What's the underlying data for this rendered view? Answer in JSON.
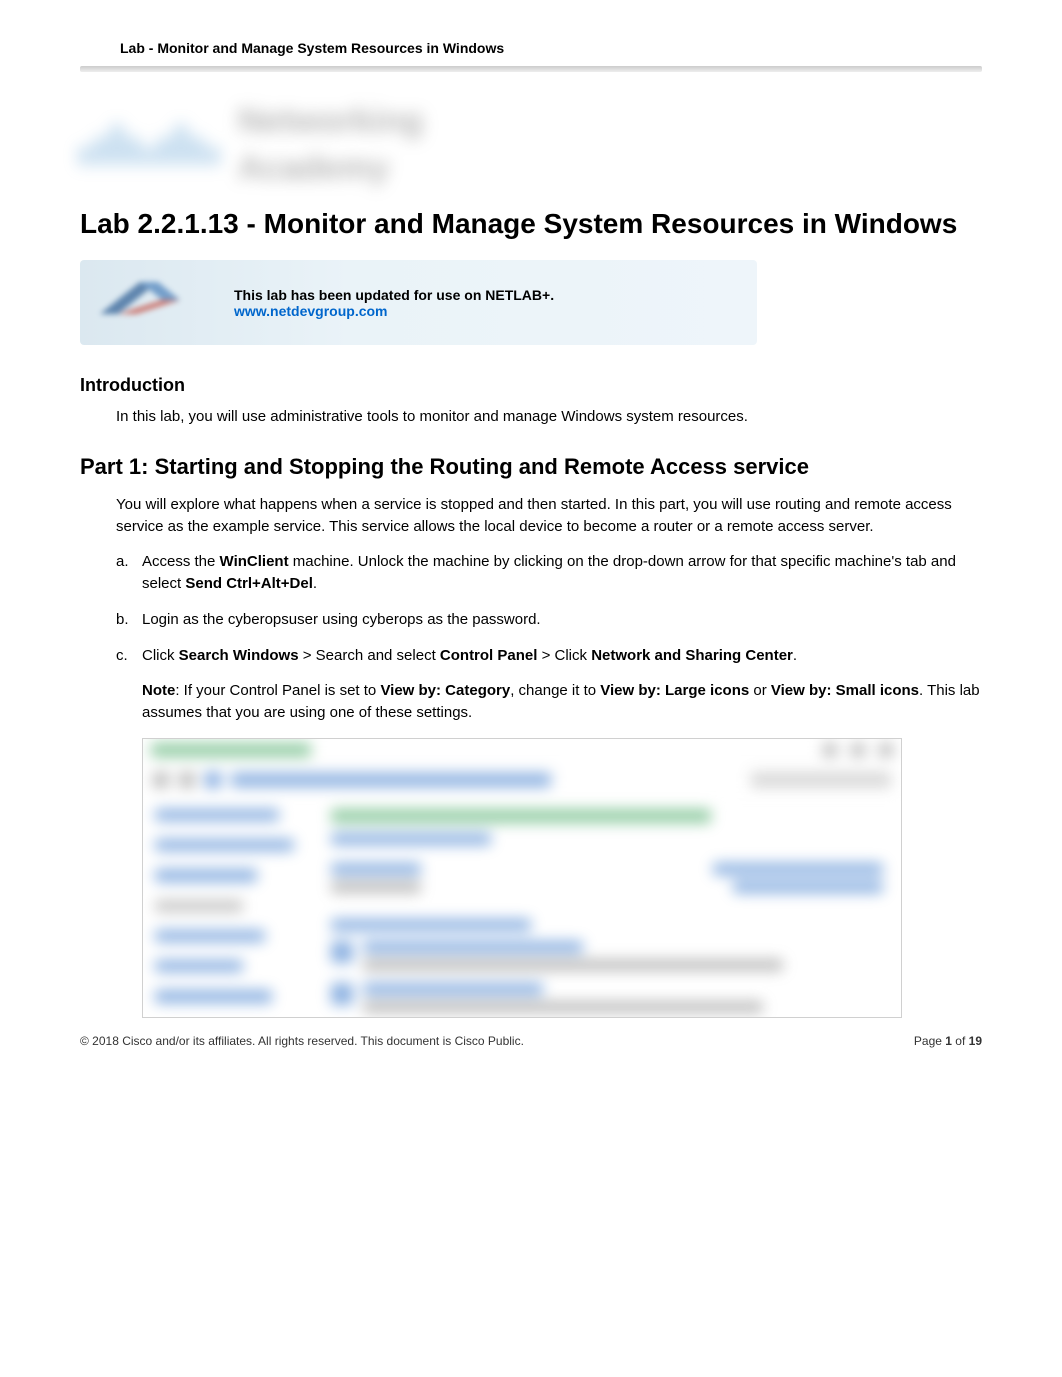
{
  "header": {
    "label": "Lab - Monitor and Manage System Resources in Windows"
  },
  "logo_block": {
    "top_word": "Networking",
    "bottom_word": "Academy"
  },
  "lab_title": "Lab 2.2.1.13 - Monitor and Manage System Resources in Windows",
  "ndg_box": {
    "line1": "This lab has been updated for use on NETLAB+.",
    "line2": "www.netdevgroup.com"
  },
  "intro": {
    "heading": "Introduction",
    "para": "In this lab, you will use administrative tools to monitor and manage Windows system resources."
  },
  "part1": {
    "heading": "Part 1: Starting and Stopping the Routing and Remote Access service",
    "para": "You will explore what happens when a service is stopped and then started. In this part, you will use routing and remote access service as the example service. This service allows the local device to become a router or a remote access server.",
    "steps": {
      "a": {
        "marker": "a.",
        "pre1": "Access   the ",
        "bold1": "WinClient",
        "mid1": " machine. Unlock the machine by clicking on the drop-down arrow for that specific machine's tab and select ",
        "bold2": "Send Ctrl+Alt+Del",
        "post1": "."
      },
      "b": {
        "marker": "b.",
        "pre1": "Login  as  the ",
        "mono1": "cyberopsuser",
        "mid1": "    using ",
        "mono2": "cyberops",
        "post1": "   as the password."
      },
      "c": {
        "marker": "c.",
        "pre1": " Click ",
        "bold1": "Search Windows",
        "mid1": " > Search and select ",
        "bold2": "Control Panel",
        "mid2": " > Click ",
        "bold3": "Network and Sharing Center",
        "post1": "."
      },
      "note": {
        "bold1": "Note",
        "mid1": ": If your Control Panel is set to ",
        "bold2": "View by: Category",
        "mid2": ", change it to ",
        "bold3": "View by: Large icons",
        "mid3": " or ",
        "bold4": "View by: Small icons",
        "post1": ". This lab assumes that you are using one of these settings."
      }
    }
  },
  "footer": {
    "copyright": "© 2018 Cisco and/or its affiliates. All rights reserved. This document is Cisco Public.",
    "page_label_pre": "Page ",
    "page_num": "1",
    "page_label_mid": " of ",
    "page_total": "19"
  }
}
